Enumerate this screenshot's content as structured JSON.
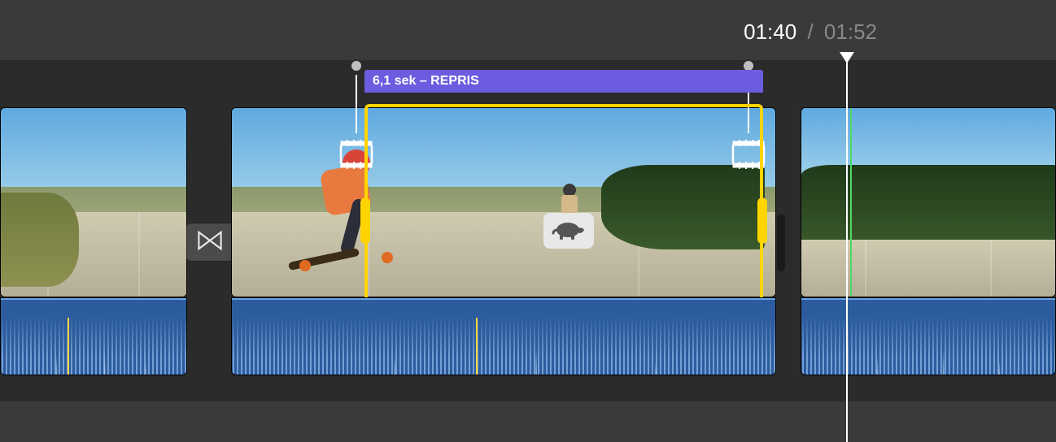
{
  "timecode": {
    "current": "01:40",
    "separator": "/",
    "total": "01:52"
  },
  "speed_segment": {
    "label": "6,1 sek – REPRIS",
    "effect": "slow-motion",
    "icon": "turtle-icon"
  },
  "colors": {
    "selection": "#ffd400",
    "speed_label_bg": "#6b5ce0",
    "audio_bg": "#2d5c9e"
  },
  "transition": {
    "type": "cross-dissolve"
  }
}
